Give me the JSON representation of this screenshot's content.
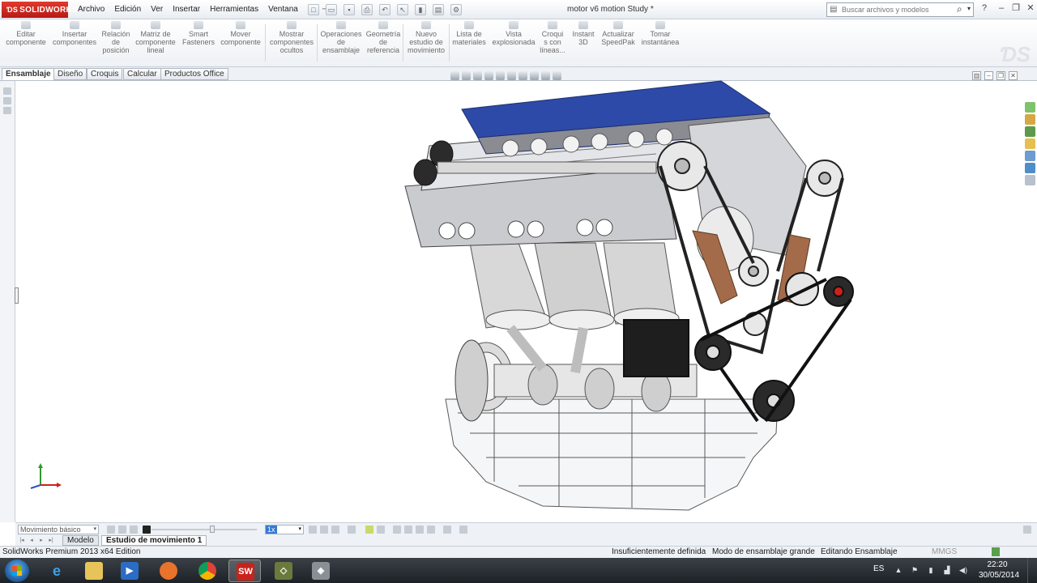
{
  "app": {
    "brand": "SOLIDWORKS",
    "document_title": "motor v6 motion Study *"
  },
  "menu": [
    "Archivo",
    "Edición",
    "Ver",
    "Insertar",
    "Herramientas",
    "Ventana",
    "?"
  ],
  "search": {
    "placeholder": "Buscar archivos y modelos"
  },
  "command_manager": [
    {
      "label": "Editar\ncomponente"
    },
    {
      "label": "Insertar\ncomponentes"
    },
    {
      "label": "Relación\nde\nposición"
    },
    {
      "label": "Matriz de\ncomponente\nlineal"
    },
    {
      "label": "Smart\nFasteners"
    },
    {
      "label": "Mover\ncomponente"
    },
    {
      "label": "Mostrar\ncomponentes\nocultos"
    },
    {
      "label": "Operaciones\nde\nensamblaje"
    },
    {
      "label": "Geometría\nde\nreferencia"
    },
    {
      "label": "Nuevo\nestudio de\nmovimiento"
    },
    {
      "label": "Lista de\nmateriales"
    },
    {
      "label": "Vista\nexplosionada"
    },
    {
      "label": "Croqui\ns con\nlíneas..."
    },
    {
      "label": "Instant\n3D"
    },
    {
      "label": "Actualizar\nSpeedPak"
    },
    {
      "label": "Tomar\ninstantánea"
    }
  ],
  "tabs": [
    "Ensamblaje",
    "Diseño",
    "Croquis",
    "Calcular",
    "Productos Office"
  ],
  "motion_manager": {
    "study_type": "Movimiento básico",
    "playback_speed": "1x",
    "tabs": [
      "Modelo",
      "Estudio de movimiento 1"
    ]
  },
  "status": {
    "edition": "SolidWorks Premium 2013 x64 Edition",
    "definition": "Insuficientemente definida",
    "mode": "Modo de ensamblaje grande",
    "editing": "Editando Ensamblaje",
    "units": "MMGS"
  },
  "taskbar": {
    "language": "ES",
    "time": "22:20",
    "date": "30/05/2014"
  },
  "colors": {
    "engine_cover": "#2e4aa8",
    "accent_red": "#c8231b",
    "tensioner": "#a36b4a"
  }
}
